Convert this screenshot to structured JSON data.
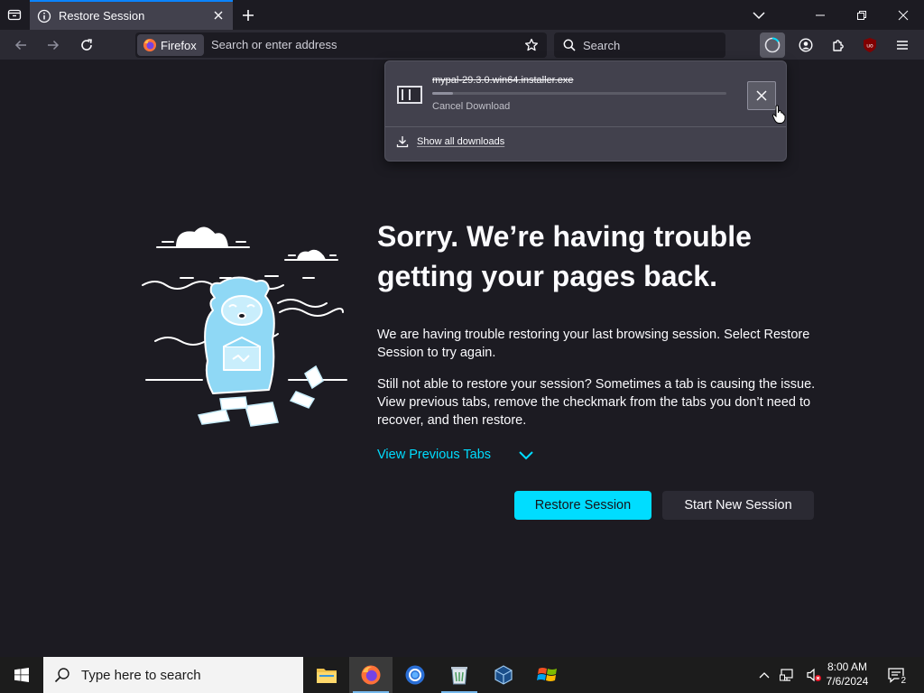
{
  "tab": {
    "title": "Restore Session",
    "info_icon": "info-icon",
    "close_icon": "close-icon"
  },
  "toolbar": {
    "identity_label": "Firefox",
    "url_placeholder": "Search or enter address",
    "search_placeholder": "Search"
  },
  "downloads_panel": {
    "filename": "mypal-29.3.0.win64.installer.exe",
    "status": "Cancel Download",
    "progress": 0.07,
    "show_all": "Show all downloads"
  },
  "content": {
    "title": "Sorry. We’re having trouble getting your pages back.",
    "paragraph1": "We are having trouble restoring your last browsing session. Select Restore Session to try again.",
    "paragraph2": "Still not able to restore your session? Sometimes a tab is causing the issue. View previous tabs, remove the checkmark from the tabs you don’t need to recover, and then restore.",
    "view_previous": "View Previous Tabs",
    "restore_button": "Restore Session",
    "new_session_button": "Start New Session"
  },
  "taskbar": {
    "search_placeholder": "Type here to search",
    "time": "8:00 AM",
    "date": "7/6/2024",
    "notification_count": "2"
  },
  "colors": {
    "accent": "#00ddff",
    "background": "#1c1b22",
    "toolbar": "#2b2a33",
    "active_tab": "#42414d"
  }
}
